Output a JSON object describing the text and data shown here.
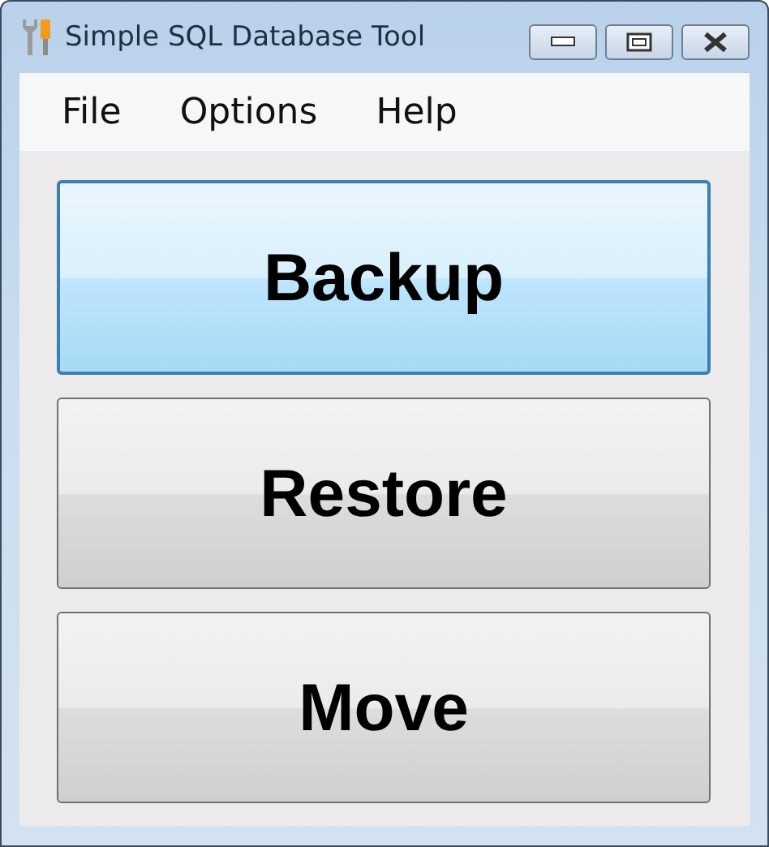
{
  "window": {
    "title": "Simple SQL Database Tool"
  },
  "menu": [
    {
      "label": "File"
    },
    {
      "label": "Options"
    },
    {
      "label": "Help"
    }
  ],
  "buttons": [
    {
      "label": "Backup",
      "focused": true
    },
    {
      "label": "Restore",
      "focused": false
    },
    {
      "label": "Move",
      "focused": false
    }
  ]
}
